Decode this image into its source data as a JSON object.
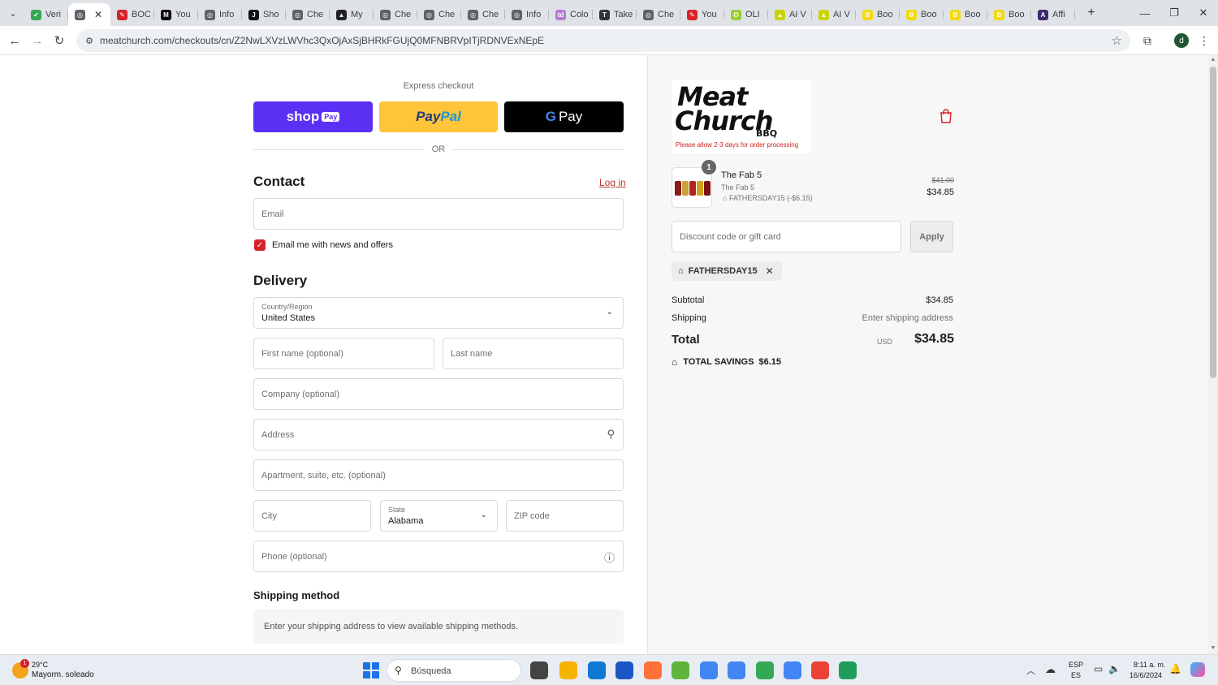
{
  "browser": {
    "tabs": [
      {
        "label": "Veri",
        "favicon_color": "#34a853",
        "favicon_glyph": "✔"
      },
      {
        "label": "",
        "favicon_color": "#5f6368",
        "favicon_glyph": "◎",
        "active": true
      },
      {
        "label": "BOC",
        "favicon_color": "#d6232a",
        "favicon_glyph": "✎"
      },
      {
        "label": "You",
        "favicon_color": "#000000",
        "favicon_glyph": "M"
      },
      {
        "label": "Info",
        "favicon_color": "#5f6368",
        "favicon_glyph": "◎"
      },
      {
        "label": "Sho",
        "favicon_color": "#111111",
        "favicon_glyph": "J"
      },
      {
        "label": "Che",
        "favicon_color": "#5f6368",
        "favicon_glyph": "◎"
      },
      {
        "label": "My",
        "favicon_color": "#222222",
        "favicon_glyph": "▲"
      },
      {
        "label": "Che",
        "favicon_color": "#5f6368",
        "favicon_glyph": "◎"
      },
      {
        "label": "Che",
        "favicon_color": "#5f6368",
        "favicon_glyph": "◎"
      },
      {
        "label": "Che",
        "favicon_color": "#5f6368",
        "favicon_glyph": "◎"
      },
      {
        "label": "Info",
        "favicon_color": "#5f6368",
        "favicon_glyph": "◎"
      },
      {
        "label": "Colo",
        "favicon_color": "#b57bd6",
        "favicon_glyph": "td"
      },
      {
        "label": "Take",
        "favicon_color": "#333333",
        "favicon_glyph": "T"
      },
      {
        "label": "Che",
        "favicon_color": "#5f6368",
        "favicon_glyph": "◎"
      },
      {
        "label": "You",
        "favicon_color": "#d6232a",
        "favicon_glyph": "✎"
      },
      {
        "label": "OLI",
        "favicon_color": "#9acd32",
        "favicon_glyph": "O"
      },
      {
        "label": "AI V",
        "favicon_color": "#c8d400",
        "favicon_glyph": "▲"
      },
      {
        "label": "AI V",
        "favicon_color": "#c8d400",
        "favicon_glyph": "▲"
      },
      {
        "label": "Boo",
        "favicon_color": "#f5d90a",
        "favicon_glyph": "B"
      },
      {
        "label": "Boo",
        "favicon_color": "#f5d90a",
        "favicon_glyph": "B"
      },
      {
        "label": "Boo",
        "favicon_color": "#f5d90a",
        "favicon_glyph": "B"
      },
      {
        "label": "Boo",
        "favicon_color": "#f5d90a",
        "favicon_glyph": "B"
      },
      {
        "label": "Affi",
        "favicon_color": "#3d2a6d",
        "favicon_glyph": "A"
      }
    ],
    "url": "meatchurch.com/checkouts/cn/Z2NwLXVzLWVhc3QxOjAxSjBHRkFGUjQ0MFNBRVpITjRDNVExNEpE"
  },
  "checkout": {
    "express_label": "Express checkout",
    "shop_pay": {
      "word": "shop",
      "badge": "Pay"
    },
    "paypal": {
      "part1": "Pay",
      "part2": "Pal"
    },
    "gpay": {
      "g": "G",
      "word": "Pay"
    },
    "or_text": "OR",
    "contact": {
      "title": "Contact",
      "login_link": "Log in",
      "email_placeholder": "Email",
      "newsletter_label": "Email me with news and offers",
      "newsletter_checked": true
    },
    "delivery": {
      "title": "Delivery",
      "country_label": "Country/Region",
      "country_value": "United States",
      "first_name_placeholder": "First name (optional)",
      "last_name_placeholder": "Last name",
      "company_placeholder": "Company (optional)",
      "address_placeholder": "Address",
      "apartment_placeholder": "Apartment, suite, etc. (optional)",
      "city_placeholder": "City",
      "state_label": "State",
      "state_value": "Alabama",
      "zip_placeholder": "ZIP code",
      "phone_placeholder": "Phone (optional)"
    },
    "shipping_method": {
      "title": "Shipping method",
      "message": "Enter your shipping address to view available shipping methods."
    }
  },
  "summary": {
    "logo": {
      "line1": "Meat",
      "line2": "Church",
      "line3": "BBQ",
      "note": "Please allow 2-3 days for order processing"
    },
    "item": {
      "quantity": "1",
      "name": "The Fab 5",
      "variant": "The Fab 5",
      "discount": "FATHERSDAY15 (-$6.15)",
      "price_original": "$41.00",
      "price_final": "$34.85"
    },
    "discount_placeholder": "Discount code or gift card",
    "apply_label": "Apply",
    "applied_code": "FATHERSDAY15",
    "subtotal_label": "Subtotal",
    "subtotal_value": "$34.85",
    "shipping_label": "Shipping",
    "shipping_value": "Enter shipping address",
    "total_label": "Total",
    "total_currency": "USD",
    "total_value": "$34.85",
    "savings_label": "TOTAL SAVINGS",
    "savings_value": "$6.15",
    "accent_color": "#d6232a"
  },
  "taskbar": {
    "weather_badge": "1",
    "weather_temp": "29°C",
    "weather_desc": "Mayorm. soleado",
    "search_placeholder": "Búsqueda",
    "lang_line1": "ESP",
    "lang_line2": "ES",
    "time": "8:11 a. m.",
    "date": "16/6/2024",
    "apps": [
      {
        "name": "task-view",
        "color": "#444444"
      },
      {
        "name": "file-explorer",
        "color": "#f5b400"
      },
      {
        "name": "edge",
        "color": "#0f78d4"
      },
      {
        "name": "store",
        "color": "#1a56c4"
      },
      {
        "name": "firefox",
        "color": "#ff7139"
      },
      {
        "name": "utorrent",
        "color": "#5fb53b"
      },
      {
        "name": "chrome-1",
        "color": "#4285f4"
      },
      {
        "name": "chrome-2",
        "color": "#4285f4"
      },
      {
        "name": "chrome-3",
        "color": "#34a853"
      },
      {
        "name": "chrome-4",
        "color": "#4285f4"
      },
      {
        "name": "chrome-5",
        "color": "#ea4335"
      },
      {
        "name": "security-app",
        "color": "#1e9e5a"
      }
    ]
  }
}
